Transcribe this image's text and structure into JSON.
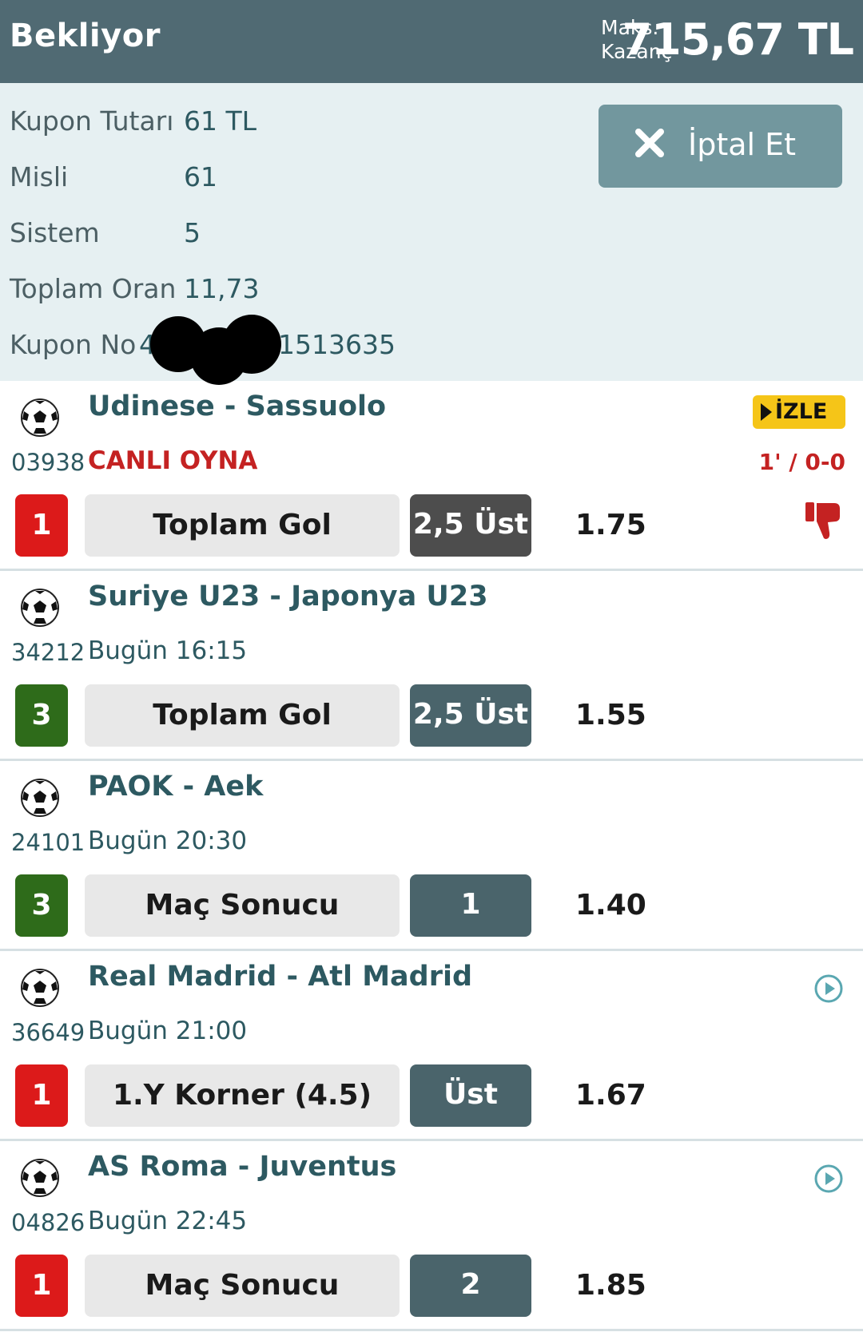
{
  "header": {
    "status": "Bekliyor",
    "max_label_1": "Maks.",
    "max_label_2": "Kazanç",
    "max_win": "715,67 TL"
  },
  "summary": [
    {
      "label": "Kupon Tutarı",
      "value": "61 TL"
    },
    {
      "label": "Misli",
      "value": "61"
    },
    {
      "label": "Sistem",
      "value": "5"
    },
    {
      "label": "Toplam Oran",
      "value": "11,73"
    },
    {
      "label": "Kupon No",
      "value_prefix": "4",
      "value_suffix": "1513635"
    }
  ],
  "cancel_button": "İptal Et",
  "matches": [
    {
      "teams": "Udinese - Sassuolo",
      "code": "03938",
      "time": "CANLI OYNA",
      "live": true,
      "score": "1' / 0-0",
      "watch": "İZLE",
      "mbs": "1",
      "mbs_color": "#dc1a1a",
      "market": "Toplam Gol",
      "pick": "2,5 Üst",
      "odd": "1.75",
      "icon": "thumbs-down-icon"
    },
    {
      "teams": "Suriye U23 - Japonya U23",
      "code": "34212",
      "time": "Bugün 16:15",
      "mbs": "3",
      "mbs_color": "#2e6b1a",
      "market": "Toplam Gol",
      "pick": "2,5 Üst",
      "odd": "1.55"
    },
    {
      "teams": "PAOK - Aek",
      "code": "24101",
      "time": "Bugün 20:30",
      "mbs": "3",
      "mbs_color": "#2e6b1a",
      "market": "Maç Sonucu",
      "pick": "1",
      "odd": "1.40"
    },
    {
      "teams": "Real Madrid - Atl Madrid",
      "code": "36649",
      "time": "Bugün 21:00",
      "mbs": "1",
      "mbs_color": "#dc1a1a",
      "market": "1.Y Korner (4.5)",
      "pick": "Üst",
      "odd": "1.67",
      "icon": "play-circle-icon"
    },
    {
      "teams": "AS Roma - Juventus",
      "code": "04826",
      "time": "Bugün 22:45",
      "mbs": "1",
      "mbs_color": "#dc1a1a",
      "market": "Maç Sonucu",
      "pick": "2",
      "odd": "1.85",
      "icon": "play-circle-icon"
    }
  ]
}
